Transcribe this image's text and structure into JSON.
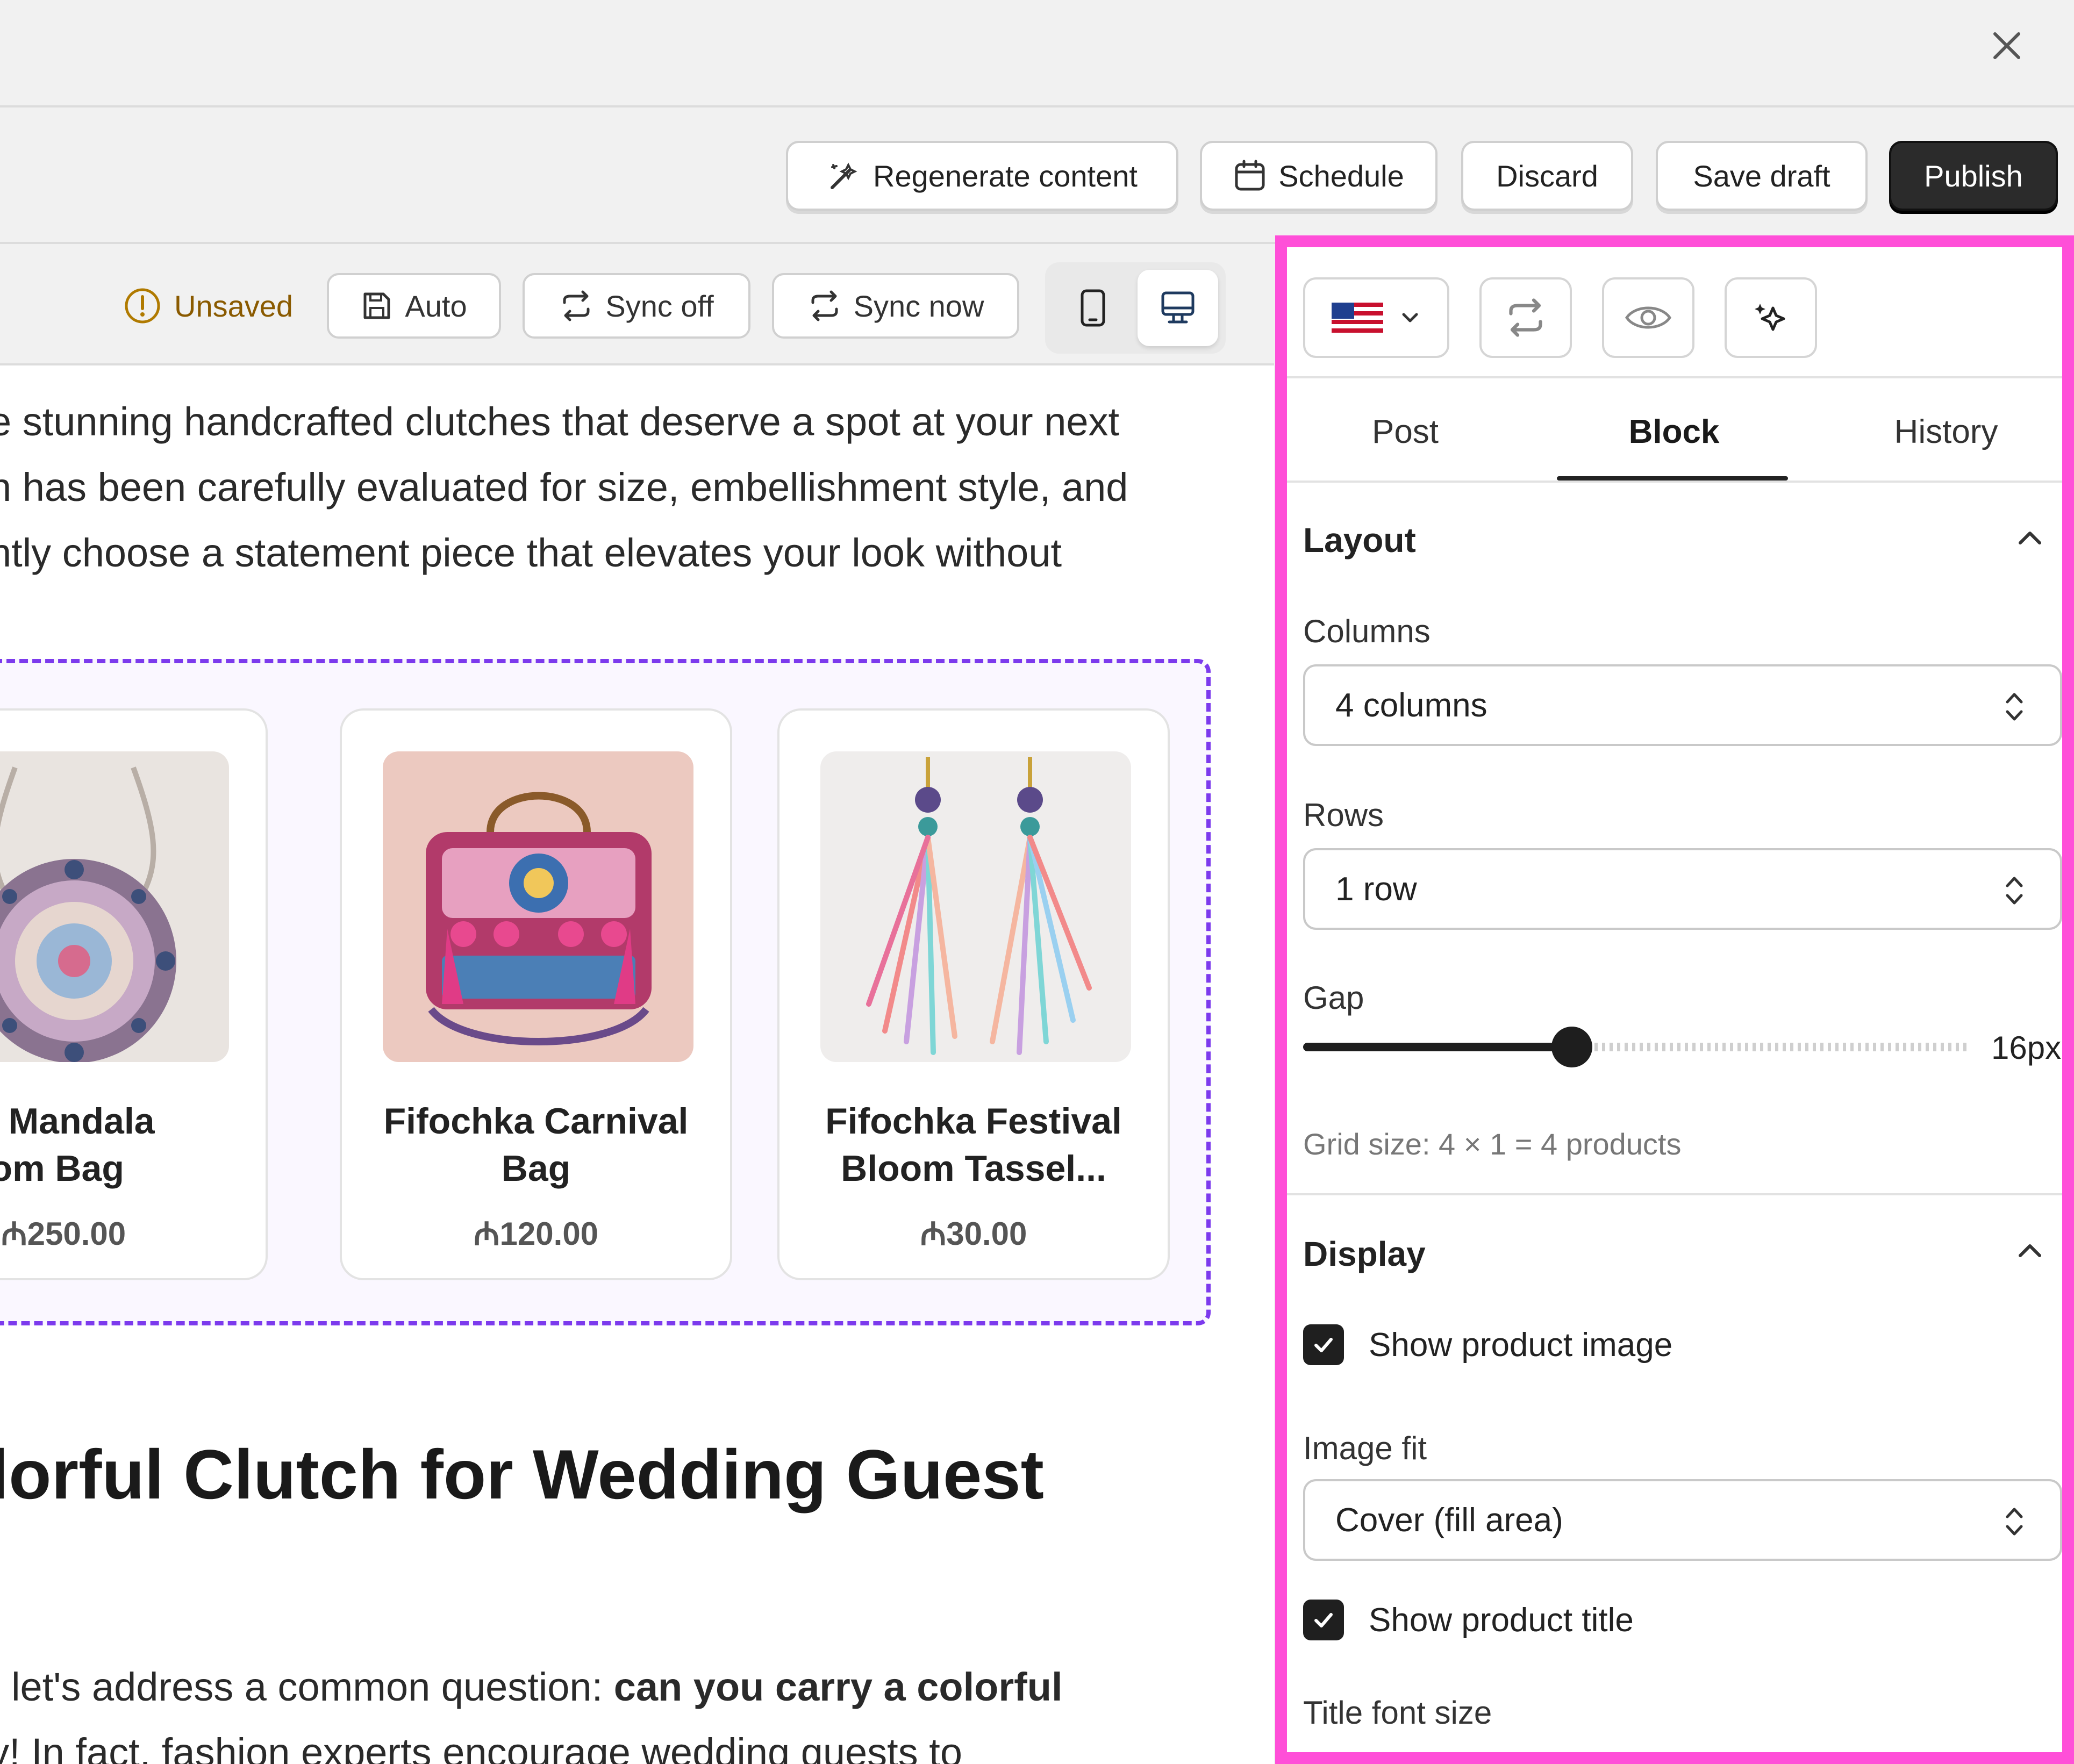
{
  "toolbar": {
    "regenerate_label": "Regenerate content",
    "schedule_label": "Schedule",
    "discard_label": "Discard",
    "save_draft_label": "Save draft",
    "publish_label": "Publish"
  },
  "editor_bar": {
    "unsaved_label": "Unsaved",
    "auto_label": "Auto",
    "sync_off_label": "Sync off",
    "sync_now_label": "Sync now"
  },
  "content": {
    "para1_line1": "e stunning handcrafted clutches that deserve a spot at your next",
    "para1_line2": "n has been carefully evaluated for size, embellishment style, and",
    "para1_line3": "ntly choose a statement piece that elevates your look without",
    "heading": "lorful Clutch for Wedding Guest",
    "para2_line1_a": ", let's address a common question: ",
    "para2_line1_b": "can you carry a colorful",
    "para2_line2": "y! In fact, fashion experts encourage wedding guests to"
  },
  "products": [
    {
      "title_line1": "oho Mandala",
      "title_line2": "Bloom Bag",
      "price": "₼250.00"
    },
    {
      "title_line1": "Fifochka Carnival",
      "title_line2": "Bag",
      "price": "₼120.00"
    },
    {
      "title_line1": "Fifochka Festival",
      "title_line2": "Bloom Tassel...",
      "price": "₼30.00"
    }
  ],
  "panel": {
    "tabs": [
      "Post",
      "Block",
      "History"
    ],
    "active_tab": "Block",
    "layout": {
      "title": "Layout",
      "columns_label": "Columns",
      "columns_value": "4 columns",
      "rows_label": "Rows",
      "rows_value": "1 row",
      "gap_label": "Gap",
      "gap_value": "16px",
      "grid_size": "Grid size: 4 × 1 = 4 products"
    },
    "display": {
      "title": "Display",
      "show_image_label": "Show product image",
      "image_fit_label": "Image fit",
      "image_fit_value": "Cover (fill area)",
      "show_title_label": "Show product title",
      "title_font_size_label": "Title font size"
    }
  },
  "colors": {
    "accent_border": "#ff4fd8",
    "block_outline": "#7c3aed",
    "primary_button": "#2b2b2b"
  },
  "icons": [
    "close-icon",
    "magic-wand-icon",
    "calendar-icon",
    "warning-icon",
    "save-icon",
    "sync-icon",
    "mobile-icon",
    "desktop-icon",
    "us-flag-icon",
    "chevron-down-icon",
    "swap-icon",
    "eye-icon",
    "sparkle-icon",
    "chevron-up-icon",
    "check-icon",
    "up-down-arrows-icon"
  ]
}
